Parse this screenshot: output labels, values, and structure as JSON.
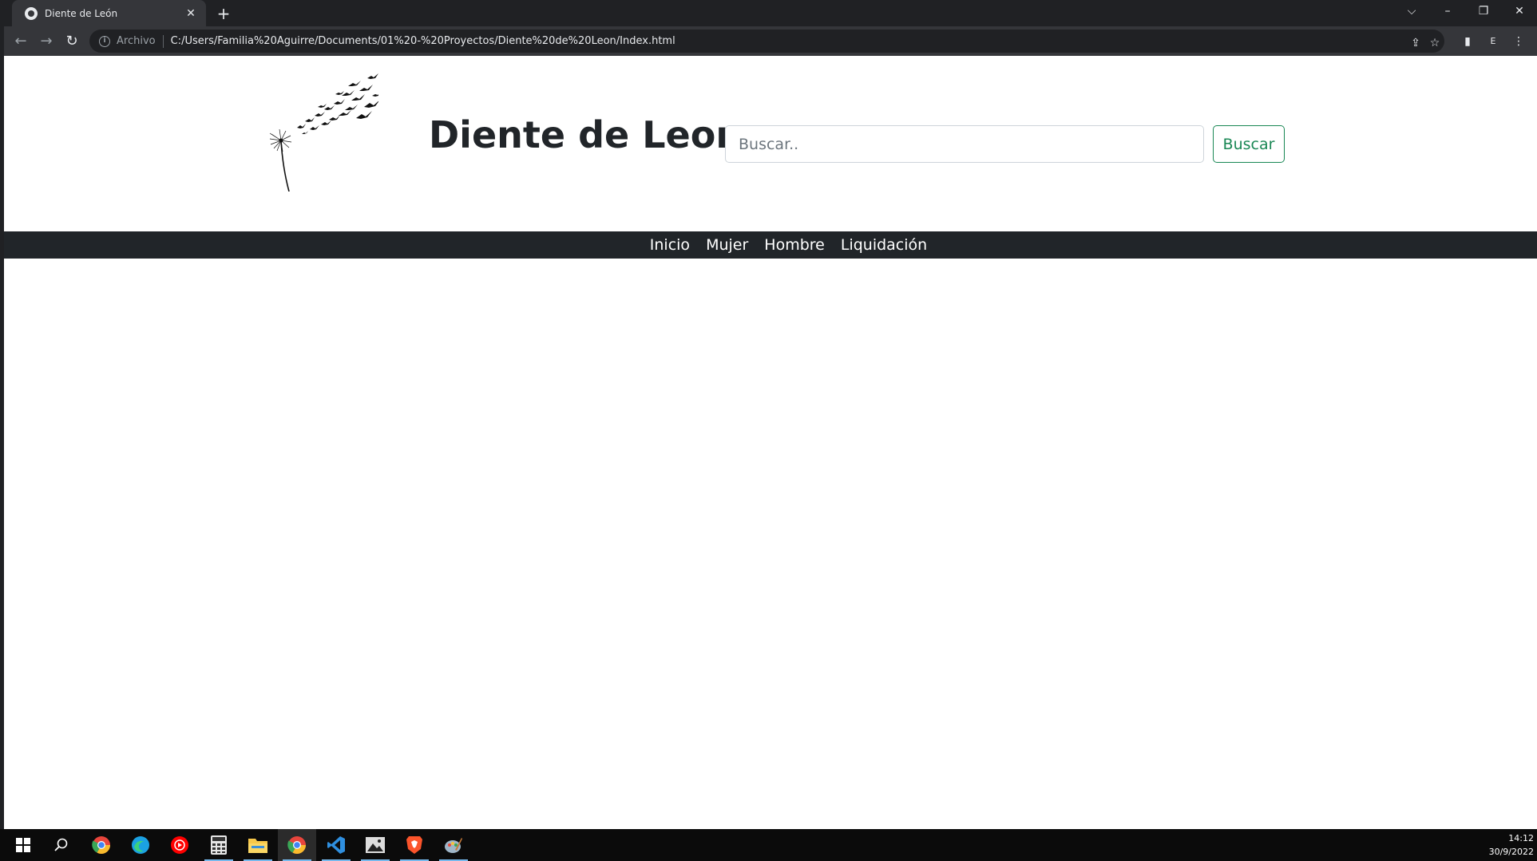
{
  "browser": {
    "tab_title": "Diente de León",
    "tab_close": "✕",
    "new_tab": "+",
    "window_controls": {
      "list": "⌵",
      "minimize": "–",
      "restore": "❐",
      "close": "✕"
    },
    "nav": {
      "back": "←",
      "forward": "→",
      "reload": "↻"
    },
    "omnibox": {
      "info": "i",
      "scheme_label": "Archivo",
      "url": "C:/Users/Familia%20Aguirre/Documents/01%20-%20Proyectos/Diente%20de%20Leon/Index.html"
    },
    "toolbar_icons": {
      "share": "⇪",
      "bookmark": "☆",
      "side_panel": "▮",
      "profile": "E",
      "menu": "⋮"
    }
  },
  "page": {
    "site_title": "Diente de Leon",
    "search": {
      "placeholder": "Buscar..",
      "value": "",
      "button_label": "Buscar"
    },
    "nav_items": [
      {
        "label": "Inicio"
      },
      {
        "label": "Mujer"
      },
      {
        "label": "Hombre"
      },
      {
        "label": "Liquidación"
      }
    ]
  },
  "taskbar": {
    "apps": [
      {
        "name": "start",
        "color": "#ffffff"
      },
      {
        "name": "search",
        "color": "#ffffff"
      },
      {
        "name": "chrome",
        "color": "#e8453c"
      },
      {
        "name": "edge",
        "color": "#1ba1e2"
      },
      {
        "name": "youtube-music",
        "color": "#ff0000"
      },
      {
        "name": "calculator",
        "color": "#e6e6e6"
      },
      {
        "name": "file-explorer",
        "color": "#f8c84a"
      },
      {
        "name": "chrome",
        "color": "#e8453c"
      },
      {
        "name": "vscode",
        "color": "#2f8fdf"
      },
      {
        "name": "photos",
        "color": "#dddddd"
      },
      {
        "name": "brave",
        "color": "#fb542b"
      },
      {
        "name": "paint",
        "color": "#9fb6c8"
      }
    ],
    "time": "14:12",
    "date": "30/9/2022"
  }
}
